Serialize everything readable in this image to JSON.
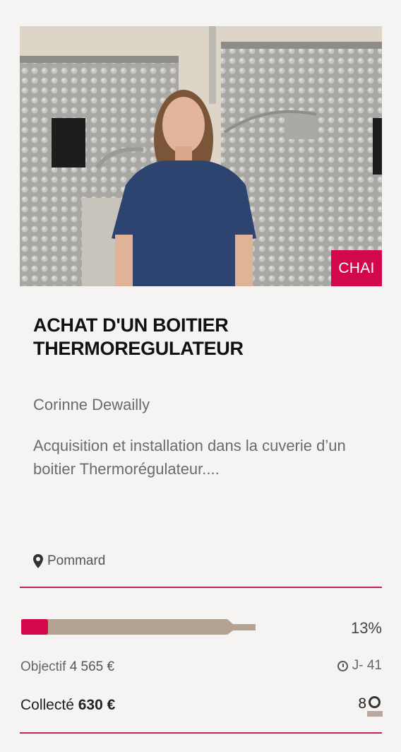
{
  "project": {
    "category_tag": "CHAI",
    "title": "ACHAT D'UN BOITIER THERMOREGULATEUR",
    "author": "Corinne Dewailly",
    "description": "Acquisition et installation dans la cuverie d’un boitier Thermorégulateur....",
    "location": "Pommard"
  },
  "funding": {
    "progress_percent": 13,
    "percent_label": "13%",
    "objective_label": "Objectif",
    "objective_amount": "4 565 €",
    "deadline": "J- 41",
    "collected_label": "Collecté",
    "collected_amount": "630 €",
    "contributors_count": "8"
  },
  "colors": {
    "accent": "#d3074c",
    "progress_track": "#b4a393",
    "divider": "#c0245c"
  },
  "icons": {
    "location": "map-pin-icon",
    "deadline": "clock-icon",
    "contributors": "user-icon"
  }
}
